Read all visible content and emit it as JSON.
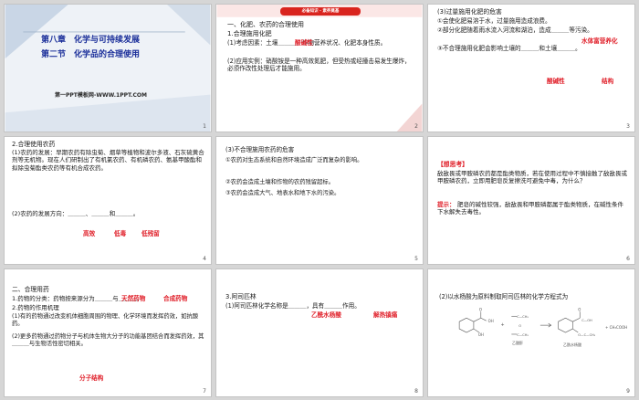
{
  "slides": [
    {
      "number": "1",
      "chapter": "第八章　化学与可持续发展",
      "section": "第二节　化学品的合理使用",
      "footer": "第一PPT模板网-WWW.1PPT.COM"
    },
    {
      "number": "2",
      "banner": "必备知识 · 素养奠基",
      "heading": "一、化肥、农药的合理使用",
      "sub1": "1.合理施用化肥",
      "p1": "(1)考虑因素：土壤＿＿＿、作物营养状况、化肥本身性质。",
      "answer1": "酸碱性",
      "p2": "(2)应用实例：硝酸铵是一种高效氮肥，但受热或经撞击易发生爆炸，必须作改性处理后才能施用。"
    },
    {
      "number": "3",
      "heading": "(3)过量施用化肥的危害",
      "items": [
        "①会使化肥易溶于水，过量施用造成浪费。",
        "②部分化肥随着雨水流入河流和湖泊，造成＿＿＿等污染。",
        "③不合理施用化肥会影响土壤的＿＿＿和土壤＿＿＿。"
      ],
      "answer_water": "水体富营养化",
      "answer_acid": "酸碱性",
      "answer_struct": "结构"
    },
    {
      "number": "4",
      "heading": "2.合理使用农药",
      "p1": "(1)农药的发展：早期农药有除虫菊、烟草等植物和波尔多液、石灰硫黄合剂等无机物。现在人们研制出了有机氯农药、有机磷农药、氨基甲酸酯和拟除虫菊酯类农药等有机合成农药。",
      "p2": "(2)农药的发展方向：＿＿＿、＿＿＿和＿＿＿。",
      "answers": [
        "高效",
        "低毒",
        "低残留"
      ]
    },
    {
      "number": "5",
      "heading": "(3)不合理施用农药的危害",
      "items": [
        "①农药对生态系统和自然环境造成广泛而复杂的影响。",
        "②农药会造成土壤和作物的农药残留超标。",
        "③农药会造成大气、地表水和地下水的污染。"
      ]
    },
    {
      "number": "6",
      "tag": "【想思考】",
      "question": "敌敌畏或甲胺磷农药都是酯类物质，若在使用过程中不慎接触了敌敌畏或甲胺磷农药，立即用肥皂反复擦洗可避免中毒，为什么？",
      "hint_label": "提示：",
      "hint": "肥皂的碱性较强，敌敌畏和甲胺磷都属于酯类物质，在碱性条件下水解失去毒性。"
    },
    {
      "number": "7",
      "heading": "二、合理用药",
      "p1": "1.药物的分类：药物按来源分为＿＿＿与＿＿＿。",
      "answer_natural": "天然药物",
      "answer_synth": "合成药物",
      "p2": "2.药物的作用机理",
      "p3": "(1)有的药物通过改变机体细胞周围的物理、化学环境而发挥药效，如抗酸药。",
      "p4": "(2)更多药物通过药物分子与机体生物大分子的功能基团结合而发挥药效，其＿＿＿与生物活性密切相关。",
      "answer_struct": "分子结构"
    },
    {
      "number": "8",
      "heading": "3.阿司匹林",
      "p1": "(1)阿司匹林化学名称是＿＿＿，具有＿＿＿作用。",
      "answer_name": "乙酰水杨酸",
      "answer_effect": "解热镇痛"
    },
    {
      "number": "9",
      "heading": "(2)以水杨酸为原料制取阿司匹林的化学方程式为",
      "reagent_label": "乙酸酐",
      "product_label": "乙酰水杨酸",
      "byproduct": "+ CH₃COOH"
    }
  ],
  "colors": {
    "accent_red": "#d9241e",
    "title_blue": "#1b2f9a",
    "answer_red": "#e0202a"
  }
}
